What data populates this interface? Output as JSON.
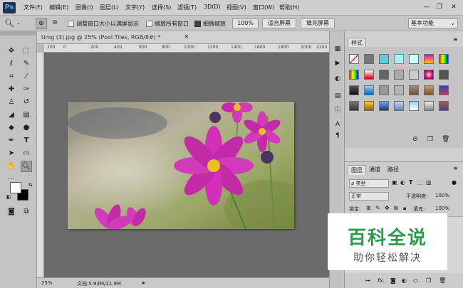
{
  "app": {
    "logo": "Ps"
  },
  "menu": [
    "文件(F)",
    "编辑(E)",
    "图像(I)",
    "图层(L)",
    "文字(Y)",
    "选择(S)",
    "滤镜(T)",
    "3D(D)",
    "视图(V)",
    "窗口(W)",
    "帮助(H)"
  ],
  "window_controls": {
    "minimize": "—",
    "restore": "❐",
    "close": "✕"
  },
  "options": {
    "resize_windows_label": "调整窗口大小以满屏显示",
    "zoom_all_label": "缩放所有窗口",
    "scrubby_zoom_label": "细微缩放",
    "scrubby_zoom_checked": true,
    "btn_100": "100%",
    "btn_fit": "适合屏幕",
    "btn_fill": "填充屏幕",
    "workspace": "基本功能"
  },
  "document": {
    "tab_title": "timg (3).jpg @ 25% (Pool Tiles, RGB/8#) *",
    "close": "×",
    "ruler_h": [
      "200",
      "0",
      "200",
      "400",
      "600",
      "800",
      "1000",
      "1200",
      "1400",
      "1600",
      "1800",
      "2000",
      "2200"
    ],
    "status_zoom": "25%",
    "status_doc": "文档:5.93M/11.9M"
  },
  "styles_panel": {
    "tab": "样式"
  },
  "layers_panel": {
    "tabs": [
      "图层",
      "通道",
      "路径"
    ],
    "filter_kind": "ρ 类型",
    "blend_mode": "正常",
    "opacity_label": "不透明度:",
    "opacity_value": "100%",
    "lock_label": "锁定:",
    "fill_label": "填充:",
    "fill_value": "100%",
    "footer_fx": "fx."
  },
  "watermark": {
    "title": "百科全说",
    "subtitle": "助你轻松解决"
  },
  "colors": {
    "menubar": "#cfcfcf",
    "canvas_bg": "#6b6b6b",
    "watermark_green": "#2a9d4b"
  }
}
